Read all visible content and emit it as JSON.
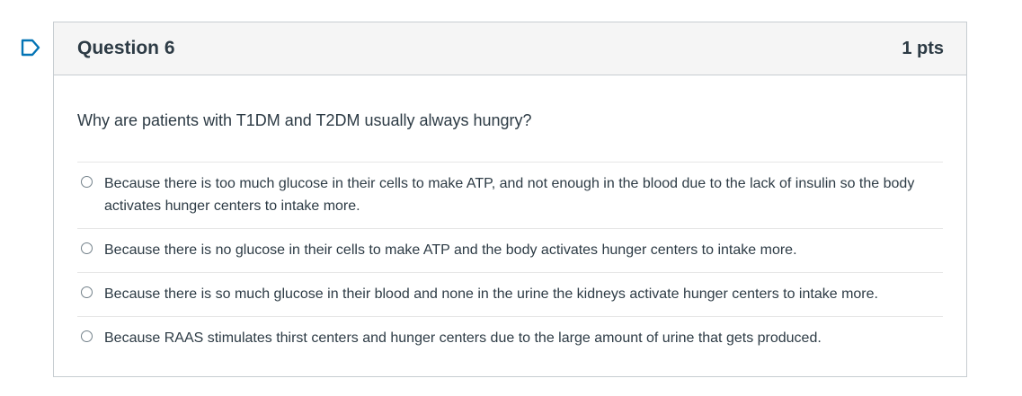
{
  "question": {
    "title": "Question 6",
    "points": "1 pts",
    "text": "Why are patients with T1DM and T2DM usually always hungry?",
    "answers": [
      {
        "label": "Because there is too much glucose in their cells to make ATP, and not enough in the blood due to the lack of insulin so the body activates hunger centers to intake more.",
        "selected": false
      },
      {
        "label": "Because there is no glucose in their cells to make ATP and the body activates hunger centers to intake more.",
        "selected": false
      },
      {
        "label": "Because there is so much glucose in their blood and none in the urine the kidneys activate hunger centers to intake more.",
        "selected": false
      },
      {
        "label": "Because RAAS stimulates thirst centers and hunger centers due to the large amount of urine that gets produced.",
        "selected": false
      }
    ]
  },
  "flag_icon": "flag-question-icon",
  "colors": {
    "flag_stroke": "#0374b5",
    "header_bg": "#f5f5f5",
    "border": "#c7cdd1",
    "text": "#2d3b45"
  }
}
